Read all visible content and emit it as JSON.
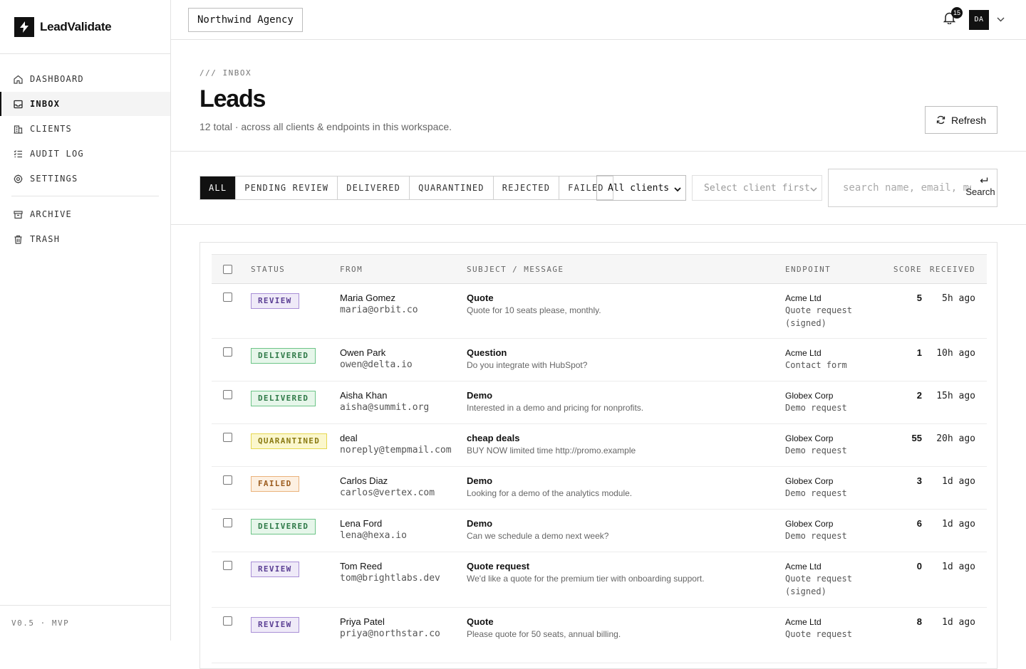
{
  "brand": {
    "name": "LeadValidate",
    "logo_icon": "bolt-icon"
  },
  "nav": {
    "primary": [
      {
        "label": "DASHBOARD",
        "icon": "home-icon",
        "active": false
      },
      {
        "label": "INBOX",
        "icon": "inbox-icon",
        "active": true
      },
      {
        "label": "CLIENTS",
        "icon": "building-icon",
        "active": false
      },
      {
        "label": "AUDIT LOG",
        "icon": "list-check-icon",
        "active": false
      },
      {
        "label": "SETTINGS",
        "icon": "gear-icon",
        "active": false
      }
    ],
    "secondary": [
      {
        "label": "ARCHIVE",
        "icon": "archive-icon"
      },
      {
        "label": "TRASH",
        "icon": "trash-icon"
      }
    ]
  },
  "version": "V0.5 · MVP",
  "topbar": {
    "workspace": "Northwind Agency",
    "notification_count": "15",
    "avatar_initials": "DA"
  },
  "header": {
    "eyebrow": "/// INBOX",
    "title": "Leads",
    "subtitle": "12 total · across all clients & endpoints in this workspace.",
    "refresh_label": "Refresh"
  },
  "filters": {
    "tabs": [
      "ALL",
      "PENDING REVIEW",
      "DELIVERED",
      "QUARANTINED",
      "REJECTED",
      "FAILED"
    ],
    "active_tab": "ALL",
    "client_select": "All clients",
    "endpoint_select": "Select client first",
    "search_placeholder": "search name, email, message",
    "search_label": "Search"
  },
  "table": {
    "headers": {
      "status": "STATUS",
      "from": "FROM",
      "subject": "SUBJECT / MESSAGE",
      "endpoint": "ENDPOINT",
      "score": "SCORE",
      "received": "RECEIVED"
    },
    "rows": [
      {
        "status": "REVIEW",
        "status_kind": "review",
        "name": "Maria Gomez",
        "email": "maria@orbit.co",
        "subject": "Quote",
        "message": "Quote for 10 seats please, monthly.",
        "client": "Acme Ltd",
        "endpoint": "Quote request (signed)",
        "score": "5",
        "received": "5h ago"
      },
      {
        "status": "DELIVERED",
        "status_kind": "delivered",
        "name": "Owen Park",
        "email": "owen@delta.io",
        "subject": "Question",
        "message": "Do you integrate with HubSpot?",
        "client": "Acme Ltd",
        "endpoint": "Contact form",
        "score": "1",
        "received": "10h ago"
      },
      {
        "status": "DELIVERED",
        "status_kind": "delivered",
        "name": "Aisha Khan",
        "email": "aisha@summit.org",
        "subject": "Demo",
        "message": "Interested in a demo and pricing for nonprofits.",
        "client": "Globex Corp",
        "endpoint": "Demo request",
        "score": "2",
        "received": "15h ago"
      },
      {
        "status": "QUARANTINED",
        "status_kind": "quarantined",
        "name": "deal",
        "email": "noreply@tempmail.com",
        "subject": "cheap deals",
        "message": "BUY NOW limited time http://promo.example",
        "client": "Globex Corp",
        "endpoint": "Demo request",
        "score": "55",
        "received": "20h ago"
      },
      {
        "status": "FAILED",
        "status_kind": "failed",
        "name": "Carlos Diaz",
        "email": "carlos@vertex.com",
        "subject": "Demo",
        "message": "Looking for a demo of the analytics module.",
        "client": "Globex Corp",
        "endpoint": "Demo request",
        "score": "3",
        "received": "1d ago"
      },
      {
        "status": "DELIVERED",
        "status_kind": "delivered",
        "name": "Lena Ford",
        "email": "lena@hexa.io",
        "subject": "Demo",
        "message": "Can we schedule a demo next week?",
        "client": "Globex Corp",
        "endpoint": "Demo request",
        "score": "6",
        "received": "1d ago"
      },
      {
        "status": "REVIEW",
        "status_kind": "review",
        "name": "Tom Reed",
        "email": "tom@brightlabs.dev",
        "subject": "Quote request",
        "message": "We'd like a quote for the premium tier with onboarding support.",
        "client": "Acme Ltd",
        "endpoint": "Quote request (signed)",
        "score": "0",
        "received": "1d ago"
      },
      {
        "status": "REVIEW",
        "status_kind": "review",
        "name": "Priya Patel",
        "email": "priya@northstar.co",
        "subject": "Quote",
        "message": "Please quote for 50 seats, annual billing.",
        "client": "Acme Ltd",
        "endpoint": "Quote request",
        "score": "8",
        "received": "1d ago"
      }
    ]
  }
}
